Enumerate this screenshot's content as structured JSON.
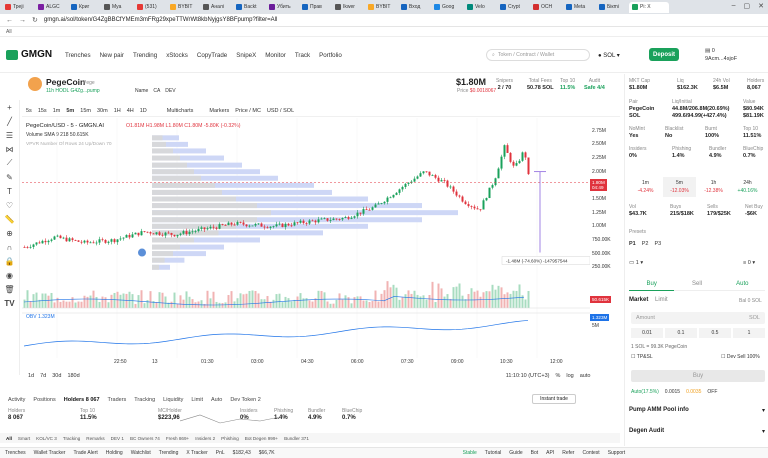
{
  "browser": {
    "tabs": [
      "Треji",
      "ALGC",
      "Криг",
      "Mya",
      "(531)",
      "BYBIT",
      "Аналі",
      "Backt",
      "Убить",
      "Прав",
      "Ikwer",
      "BYBIT",
      "Вход",
      "Goog",
      "Velo",
      "Crypt",
      "OCH",
      "Meta",
      "Бiкmi",
      "Pi: X"
    ],
    "tab_colors": [
      "#e53935",
      "#7b1fa2",
      "#1565c0",
      "#555",
      "#e53935",
      "#f9a825",
      "#555",
      "#1565c0",
      "#6a1b9a",
      "#1565c0",
      "#555",
      "#f9a825",
      "#1565c0",
      "#1e88e5",
      "#00897b",
      "#1565c0",
      "#d32f2f",
      "#1565c0",
      "#1565c0",
      "#1aa15b"
    ],
    "url": "gmgn.ai/sol/token/G4ZgBBCfYMEm3mFRg29xpeTTWrWt8kbNyjgsY8BFpump?filter=All",
    "bookmarks_label": "All"
  },
  "header": {
    "logo": "GMGN",
    "nav": [
      "Trenches",
      "New pair",
      "Trending",
      "xStocks",
      "CopyTrade",
      "SnipeX",
      "Monitor",
      "Track",
      "Portfolio"
    ],
    "search_placeholder": "Token / Contract / Wallet",
    "chain": "SOL",
    "deposit": "Deposit",
    "balance": "0",
    "account": "9Acm...4sjoF"
  },
  "coin": {
    "name": "PegeCoin",
    "ticker": "Pege",
    "age_line": "11h HODL G4Zg...pump",
    "links": [
      "Name",
      "CA",
      "DEV"
    ],
    "price": "$1.80M",
    "price_label": "Price",
    "price_change": "$0.0018067",
    "snipers_label": "Snipers",
    "snipers": "2 / 70",
    "fees_label": "Total Fees",
    "fees": "50.78 SOL",
    "top10_label": "Top 10",
    "top10": "11.5%",
    "audit_label": "Audit",
    "audit": "Safe 4/4"
  },
  "chart_toolbar": [
    "5s",
    "15s",
    "1m",
    "5m",
    "15m",
    "30m",
    "1H",
    "4H",
    "1D",
    "Multicharts",
    "Markers",
    "Price / MC",
    "USD / SOL"
  ],
  "chart_data": {
    "type": "candlestick",
    "title": "PegeCoin/USD - 5 - GMGN.AI",
    "ohlc_text": "O1.81M H1.98M L1.80M C1.80M -5.80K (-0.32%)",
    "volume_label": "Volume SMA 9  218  50.615K",
    "vpvr_label": "VPVR Number Of Rows 24 Up/Down 70",
    "obv_label": "OBV  1.323M",
    "y_ticks": [
      "2.75M",
      "2.50M",
      "2.25M",
      "2.00M",
      "1.75M",
      "1.50M",
      "1.25M",
      "1.00M",
      "750.00K",
      "500.00K",
      "250.00K"
    ],
    "x_ticks": [
      "22:50",
      "13",
      "01:30",
      "03:00",
      "04:30",
      "06:00",
      "07:30",
      "09:00",
      "10:30",
      "12:00"
    ],
    "last_price_label": "1.80M",
    "last_price_sub": "04:49",
    "volume_badge": "50.615K",
    "obv_badge": "1.323M",
    "obv_tick": "5M",
    "measure": "-1.48M (-74.60%) -147957544",
    "ylim": [
      0,
      2.9
    ]
  },
  "time_footer": {
    "ranges": [
      "1d",
      "7d",
      "30d",
      "180d"
    ],
    "clock": "11:10:10 (UTC+3)",
    "right": [
      "%",
      "log",
      "auto"
    ]
  },
  "bottom_tabs": [
    "Activity",
    "Positions",
    "Holders 8 067",
    "Traders",
    "Tracking",
    "Liquidity",
    "Limit",
    "Auto",
    "Dev Token 2"
  ],
  "instant_trade": "Instant trade",
  "holder_stats": [
    {
      "label": "Holders",
      "value": "8 067"
    },
    {
      "label": "Top 10",
      "value": "11.5%"
    },
    {
      "label": "MC/Holder",
      "value": "$223,96"
    },
    {
      "label": "Insiders",
      "value": "0%"
    },
    {
      "label": "Phishing",
      "value": "1.4%"
    },
    {
      "label": "Bundler",
      "value": "4.9%"
    },
    {
      "label": "BlueChip",
      "value": "0.7%"
    }
  ],
  "filters": [
    "All",
    "Smart",
    "KOL/VC 3",
    "Tracking",
    "Remarks",
    "DEV 1",
    "BC Owners 74",
    "Fresh 869+",
    "Insiders 2",
    "Phishing",
    "Bot Degen 999+",
    "Bundler 371"
  ],
  "bottom_bar": [
    "Trenches",
    "Wallet Tracker",
    "Trade Alert",
    "Holding",
    "Watchlist",
    "Trending",
    "X Tracker",
    "PnL",
    "$182,43",
    "$66,7K",
    "Stable",
    "Tutorial",
    "Guide",
    "Bot",
    "API",
    "Refer",
    "Contest",
    "Support"
  ],
  "right": {
    "mcap_label": "MKT Cap",
    "mcap": "$1.80M",
    "liq_label": "Liq",
    "liq": "$162.3K",
    "vol24_label": "24h Vol",
    "vol24": "$6.5M",
    "holders_label": "Holders",
    "holders": "8,067",
    "pair_label": "Pair",
    "pair_a": "PegeCoin",
    "pair_b": "SOL",
    "liqinit_label": "Liq/Initial",
    "liqinit_a": "44.8M/206.8M(20.69%)",
    "liqinit_b": "499.6/94.99(+427.4%)",
    "value_label": "Value",
    "value_a": "$80.94K",
    "value_b": "$81.19K",
    "nomint_label": "NoMint",
    "nomint": "Yes",
    "blacklist_label": "Blacklist",
    "blacklist": "No",
    "burnt_label": "Burnt",
    "burnt": "100%",
    "top10_label": "Top 10",
    "top10": "11.51%",
    "insiders_label": "Insiders",
    "insiders": "0%",
    "phishing_label": "Phishing",
    "phishing": "1.4%",
    "bundler_label": "Bundler",
    "bundler": "4.9%",
    "bluechip_label": "BlueChip",
    "bluechip": "0.7%",
    "tfs": [
      {
        "t": "1m",
        "v": "-4.24%"
      },
      {
        "t": "5m",
        "v": "-12.03%"
      },
      {
        "t": "1h",
        "v": "-12.38%"
      },
      {
        "t": "24h",
        "v": "+40.16%"
      }
    ],
    "vol_label": "Vol",
    "vol": "$43.7K",
    "buys_label": "Buys",
    "buys": "215/$18K",
    "sells_label": "Sells",
    "sells": "179/$25K",
    "netbuy_label": "Net Buy",
    "netbuy": "-$6K",
    "presets_label": "Presets",
    "presets": [
      "P1",
      "P2",
      "P3"
    ],
    "wallet_count": "1",
    "wallet_bal": "0",
    "buy": "Buy",
    "sell": "Sell",
    "auto": "Auto",
    "market": "Market",
    "limit": "Limit",
    "bal": "Bal 0 SOL",
    "amount_placeholder": "Amount",
    "amount_unit": "SOL",
    "quick": [
      "0.01",
      "0.1",
      "0.5",
      "1"
    ],
    "rate": "1 SOL = 99.3K PegeCoin",
    "tp_label": "TP&SL",
    "dev_label": "Dev Sell 100%",
    "buy_button": "Buy",
    "autofee": "Auto(17.5%)",
    "fee1": "0.0015",
    "fee2": "0.0035",
    "off": "OFF",
    "pool_label": "Pump AMM Pool info",
    "audit_label": "Degen Audit"
  }
}
